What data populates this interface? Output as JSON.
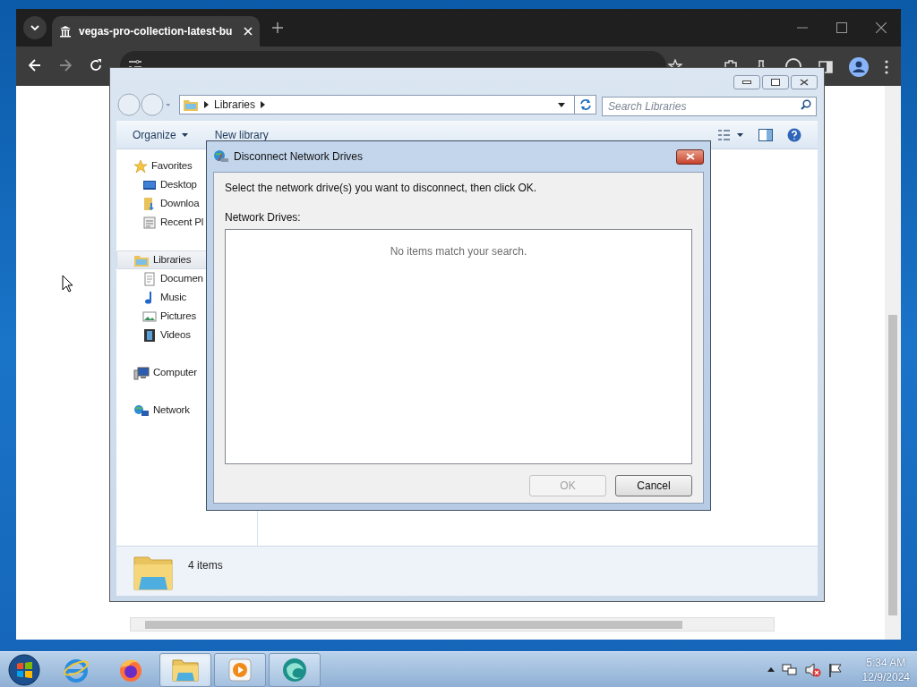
{
  "browser": {
    "tab": {
      "title": "vegas-pro-collection-latest-bu"
    }
  },
  "explorer": {
    "breadcrumb": [
      "Libraries"
    ],
    "search": {
      "placeholder": "Search Libraries"
    },
    "toolbar": [
      {
        "label": "Organize",
        "dropdown": true
      },
      {
        "label": "New library",
        "dropdown": false
      }
    ],
    "nav": [
      {
        "label": "Favorites",
        "kind": "star",
        "selected": false,
        "children": [
          {
            "label": "Desktop",
            "kind": "desktop",
            "selected": false
          },
          {
            "label": "Downloa",
            "kind": "downloads",
            "selected": false
          },
          {
            "label": "Recent Pl",
            "kind": "recent",
            "selected": false
          }
        ]
      },
      {
        "label": "Libraries",
        "kind": "library",
        "selected": true,
        "children": [
          {
            "label": "Documen",
            "kind": "document",
            "selected": false
          },
          {
            "label": "Music",
            "kind": "music",
            "selected": false
          },
          {
            "label": "Pictures",
            "kind": "pictures",
            "selected": false
          },
          {
            "label": "Videos",
            "kind": "videos",
            "selected": false
          }
        ]
      },
      {
        "label": "Computer",
        "kind": "computer",
        "selected": false
      },
      {
        "label": "Network",
        "kind": "network",
        "selected": false
      }
    ],
    "status": "4 items"
  },
  "dialog": {
    "title": "Disconnect Network Drives",
    "instruction": "Select the network drive(s) you want to disconnect, then click OK.",
    "list_label": "Network Drives:",
    "empty_text": "No items match your search.",
    "buttons": [
      {
        "label": "OK",
        "disabled": true
      },
      {
        "label": "Cancel",
        "disabled": false
      }
    ]
  },
  "taskbar": {
    "apps": [
      {
        "kind": "ie",
        "open": false,
        "selected": false
      },
      {
        "kind": "firefox",
        "open": false,
        "selected": false
      },
      {
        "kind": "explorer",
        "open": true,
        "selected": true
      },
      {
        "kind": "media",
        "open": true,
        "selected": false
      },
      {
        "kind": "app",
        "open": true,
        "selected": false
      }
    ],
    "time": "5:34 AM",
    "date": "12/9/2024"
  }
}
